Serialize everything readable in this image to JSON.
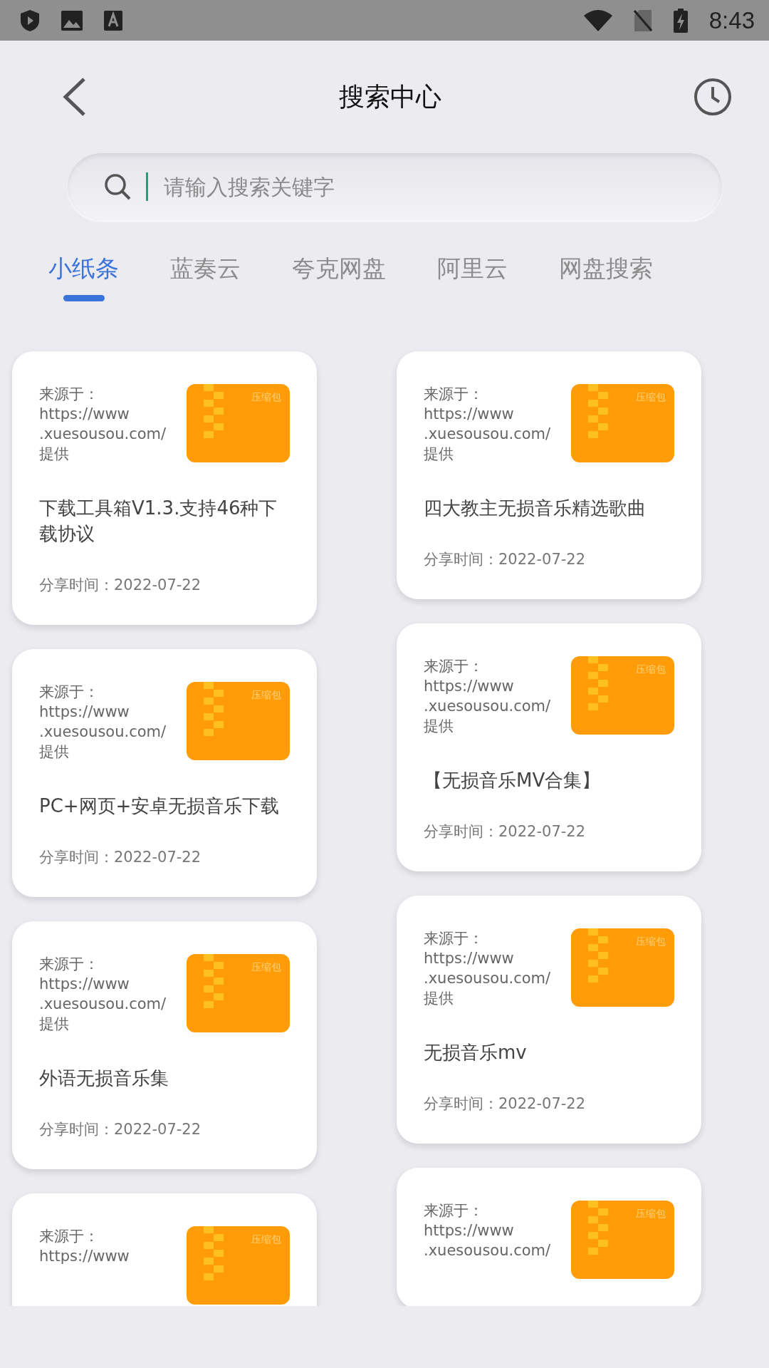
{
  "status_bar": {
    "time": "8:43"
  },
  "header": {
    "title": "搜索中心"
  },
  "search": {
    "placeholder": "请输入搜索关键字"
  },
  "tabs": [
    {
      "label": "小纸条",
      "selected": true
    },
    {
      "label": "蓝奏云",
      "selected": false
    },
    {
      "label": "夸克网盘",
      "selected": false
    },
    {
      "label": "阿里云",
      "selected": false
    },
    {
      "label": "网盘搜索",
      "selected": false
    }
  ],
  "columns": [
    {
      "cards": [
        {
          "source_lines": [
            "来源于：",
            "https://www",
            ".xuesousou.com/",
            "提供"
          ],
          "badge": "压缩包",
          "title": "下载工具箱V1.3.支持46种下载协议",
          "date": "分享时间：2022-07-22"
        },
        {
          "source_lines": [
            "来源于：",
            "https://www",
            ".xuesousou.com/",
            "提供"
          ],
          "badge": "压缩包",
          "title": "PC+网页+安卓无损音乐下载",
          "date": "分享时间：2022-07-22"
        },
        {
          "source_lines": [
            "来源于：",
            "https://www",
            ".xuesousou.com/",
            "提供"
          ],
          "badge": "压缩包",
          "title": "外语无损音乐集",
          "date": "分享时间：2022-07-22"
        },
        {
          "source_lines": [
            "来源于：",
            "https://www"
          ],
          "badge": "压缩包"
        }
      ]
    },
    {
      "cards": [
        {
          "source_lines": [
            "来源于：",
            "https://www",
            ".xuesousou.com/",
            "提供"
          ],
          "badge": "压缩包",
          "title": "四大教主无损音乐精选歌曲",
          "date": "分享时间：2022-07-22"
        },
        {
          "source_lines": [
            "来源于：",
            "https://www",
            ".xuesousou.com/",
            "提供"
          ],
          "badge": "压缩包",
          "title": "【无损音乐MV合集】",
          "date": "分享时间：2022-07-22"
        },
        {
          "source_lines": [
            "来源于：",
            "https://www",
            ".xuesousou.com/",
            "提供"
          ],
          "badge": "压缩包",
          "title": "无损音乐mv",
          "date": "分享时间：2022-07-22"
        },
        {
          "source_lines": [
            "来源于：",
            "https://www",
            ".xuesousou.com/"
          ],
          "badge": "压缩包"
        }
      ]
    }
  ]
}
